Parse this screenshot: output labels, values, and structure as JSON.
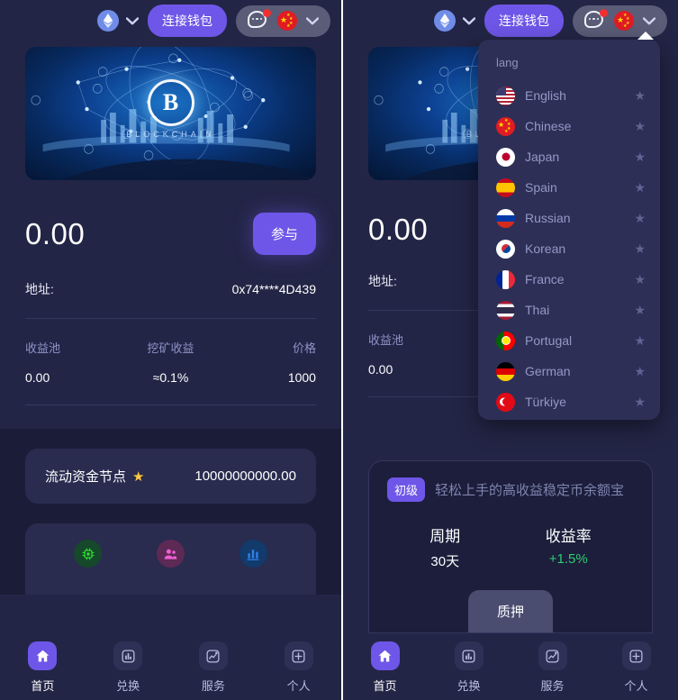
{
  "header": {
    "chain_icon": "ethereum-icon",
    "chain_chevron": "chevron-down-icon",
    "connect_label": "连接钱包",
    "chat_icon": "chat-bubble-icon",
    "notification_badge": true,
    "flag_icon": "flag-china-icon",
    "cluster_chevron": "chevron-down-icon"
  },
  "lang_dropdown": {
    "title": "lang",
    "open": true,
    "items": [
      {
        "label": "English",
        "flag": "flag-us-icon",
        "star": "★"
      },
      {
        "label": "Chinese",
        "flag": "flag-china-icon",
        "star": "★"
      },
      {
        "label": "Japan",
        "flag": "flag-japan-icon",
        "star": "★"
      },
      {
        "label": "Spain",
        "flag": "flag-spain-icon",
        "star": "★"
      },
      {
        "label": "Russian",
        "flag": "flag-russia-icon",
        "star": "★"
      },
      {
        "label": "Korean",
        "flag": "flag-korea-icon",
        "star": "★"
      },
      {
        "label": "France",
        "flag": "flag-france-icon",
        "star": "★"
      },
      {
        "label": "Thai",
        "flag": "flag-thailand-icon",
        "star": "★"
      },
      {
        "label": "Portugal",
        "flag": "flag-portugal-icon",
        "star": "★"
      },
      {
        "label": "German",
        "flag": "flag-germany-icon",
        "star": "★"
      },
      {
        "label": "Türkiye",
        "flag": "flag-turkey-icon",
        "star": "★"
      }
    ]
  },
  "banner": {
    "logo_text": "B",
    "caption": "BLOCKCHAIN"
  },
  "balance": {
    "amount": "0.00",
    "join_label": "参与"
  },
  "address": {
    "label": "地址:",
    "value": "0x74****4D439"
  },
  "stats": [
    {
      "label": "收益池",
      "value": "0.00"
    },
    {
      "label": "挖矿收益",
      "value": "≈0.1%"
    },
    {
      "label": "价格",
      "value": "1000"
    }
  ],
  "node": {
    "label": "流动资金节点",
    "star": "★",
    "value": "10000000000.00"
  },
  "feature_icons": [
    {
      "name": "cpu-chip-icon",
      "color": "#2ee02e"
    },
    {
      "name": "users-icon",
      "color": "#ee5fd0"
    },
    {
      "name": "bar-chart-icon",
      "color": "#2f7fe8"
    }
  ],
  "stake": {
    "tag": "初级",
    "title": "轻松上手的高收益稳定币余额宝",
    "period_label": "周期",
    "period_value": "30天",
    "rate_label": "收益率",
    "rate_value": "+1.5%",
    "button_label": "质押"
  },
  "bottom_nav": [
    {
      "label": "首页",
      "icon": "home-icon",
      "active": true
    },
    {
      "label": "兑换",
      "icon": "exchange-icon",
      "active": false
    },
    {
      "label": "服务",
      "icon": "services-icon",
      "active": false
    },
    {
      "label": "个人",
      "icon": "person-icon",
      "active": false
    }
  ],
  "colors": {
    "accent": "#6e56e8",
    "page_bg": "#232546",
    "lower_bg": "#1b1d38",
    "dropdown_bg": "#2d2f56",
    "green": "#2ecc71",
    "badge_red": "#f22f2f"
  }
}
